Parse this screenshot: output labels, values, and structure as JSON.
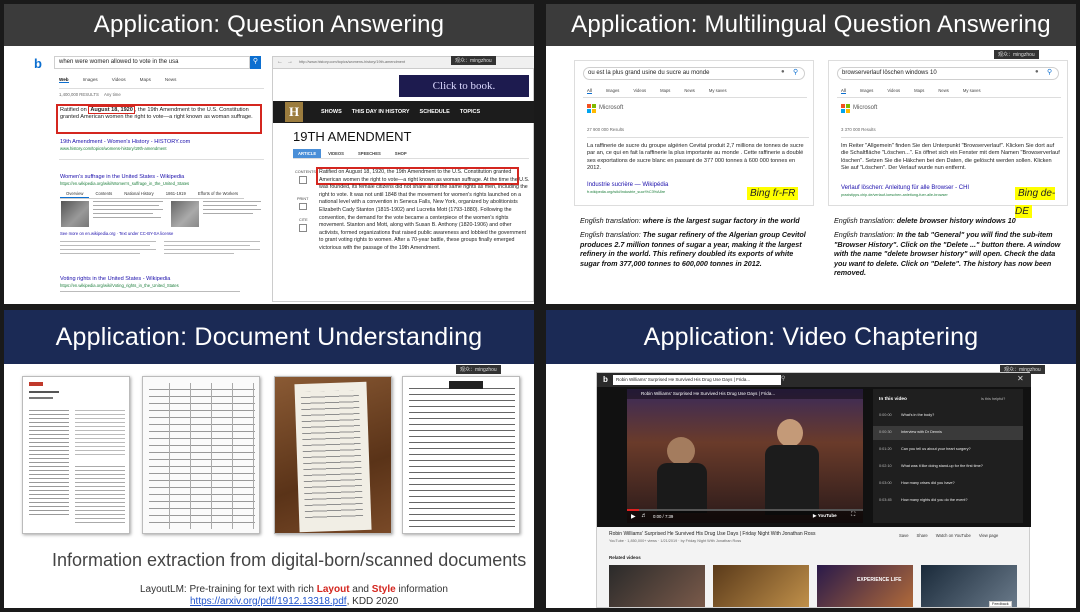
{
  "slides": {
    "qa": {
      "title": "Application: Question Answering",
      "presenter": "观众：mingzhou",
      "query": "when were women allowed to vote in the usa",
      "tabs": [
        "Web",
        "Images",
        "Videos",
        "Maps",
        "News"
      ],
      "answer_label": "1,400,000 RESULTS",
      "any_time": "Any time",
      "answer_text_pre": "Ratified on",
      "answer_highlight": "August 18, 1920",
      "answer_text_post": ", the 19th Amendment to the U.S. Constitution granted American women the right to vote—a right known as woman suffrage.",
      "result1_title": "19th Amendment - Women's History - HISTORY.com",
      "result1_url": "www.history.com/topics/womens-history/19th-amendment",
      "wiki_title": "Women's suffrage in the United States - Wikipedia",
      "wiki_url": "https://en.wikipedia.org/wiki/Women's_suffrage_in_the_United_States",
      "wiki_tabs": [
        "Overview",
        "Contents",
        "National History",
        "1861-1919",
        "Efforts of the Workers"
      ],
      "see_more": "See more on en.wikipedia.org · Text under CC-BY-SA license",
      "voting_title": "Voting rights in the United States - Wikipedia",
      "voting_url": "https://en.wikipedia.org/wiki/Voting_rights_in_the_United_States",
      "browser_url": "http://www.history.com/topics/womens-history/19th-amendment",
      "ad_text": "Click to book.",
      "nav_items": [
        "SHOWS",
        "THIS DAY IN HISTORY",
        "SCHEDULE",
        "TOPICS"
      ],
      "article_title": "19TH AMENDMENT",
      "article_tabs": [
        "ARTICLE",
        "VIDEOS",
        "SPEECHES",
        "SHOP"
      ],
      "side_labels": [
        "CONTENTS",
        "PRINT",
        "CITE"
      ],
      "article_highlight": "Ratified on August 18, 1920, the 19th Amendment to the U.S. Constitution granted American women the right to vote—a right known as woman suffrage.",
      "article_body": "At the time the U.S. was founded, its female citizens did not share all of the same rights as men, including the right to vote. It was not until 1848 that the movement for women's rights launched on a national level with a convention in Seneca Falls, New York, organized by abolitionists Elizabeth Cady Stanton (1815-1902) and Lucretia Mott (1793-1880). Following the convention, the demand for the vote became a centerpiece of the women's rights movement. Stanton and Mott, along with Susan B. Anthony (1820-1906) and other activists, formed organizations that raised public awareness and lobbied the government to grant voting rights to women. After a 70-year battle, these groups finally emerged victorious with the passage of the 19th Amendment."
    },
    "mqa": {
      "title": "Application: Multilingual Question Answering",
      "presenter": "观众：mingzhou",
      "fr_query": "ou est la plus grand usine du sucre au monde",
      "de_query": "browserverlauf löschen windows 10",
      "tabs": [
        "All",
        "Images",
        "Videos",
        "Maps",
        "News",
        "My saves"
      ],
      "fr_results": "27 900 000 Results",
      "de_results": "3 370 000 Results",
      "fr_answer": "La raffinerie de sucre du groupe algérien Cevital produit 2,7 millions de tonnes de sucre par an, ce qui en fait la raffinerie la plus importante au monde . Cette raffinerie a doublé ses exportations de sucre blanc en passant de 377 000 tonnes à 600 000 tonnes en 2012.",
      "de_answer": "Im Reiter \"Allgemein\" finden Sie den Unterpunkt \"Browserverlauf\". Klicken Sie dort auf die Schaltfläche \"Löschen...\". Es öffnet sich ein Fenster mit dem Namen \"Browserverlauf löschen\". Setzen Sie die Häkchen bei den Daten, die gelöscht werden sollen. Klicken Sie auf \"Löschen\". Der Verlauf wurde nun entfernt.",
      "fr_link": "Industrie sucrière — Wikipédia",
      "fr_link_url": "fr.wikipedia.org/wiki/Industrie_sucri%C3%A8re",
      "de_link": "Verlauf löschen: Anleitung für alle Browser - CHI",
      "de_link_url": "praxistipps.chip.de/verlauf-loeschen-anleitung-fuer-alle-browser",
      "fr_tag": "Bing fr-FR",
      "de_tag": "Bing de-DE",
      "fr_trans_label": "English translation:",
      "fr_trans_q": "where is the largest sugar factory in the world",
      "fr_trans_label2": "English translation:",
      "fr_trans_a": "The sugar refinery of the Algerian group Cevitol produces 2.7 million tonnes of sugar a year, making it the largest refinery in the world. This refinery doubled its exports of white sugar from 377,000 tonnes to 600,000 tonnes in 2012.",
      "de_trans_q": "delete browser history windows 10",
      "de_trans_a": "In the tab \"General\" you will find the sub-item \"Browser History\". Click on the \"Delete ...\" button there. A window with the name \"delete browser history\" will open. Check the data you want to delete. Click on \"Delete\". The history has now been removed."
    },
    "du": {
      "title": "Application: Document Understanding",
      "presenter": "观众：mingzhou",
      "caption": "Information extraction from digital-born/scanned documents",
      "ref_pre": "LayoutLM: Pre-training for text with rich ",
      "ref_layout": "Layout",
      "ref_and": " and ",
      "ref_style": "Style",
      "ref_post": " information",
      "ref_link": "https://arxiv.org/pdf/1912.13318.pdf",
      "ref_venue": ", KDD 2020"
    },
    "vc": {
      "title": "Application: Video Chaptering",
      "presenter": "观众：mingzhou",
      "video_title": "Robin Williams' Surprised He Survived His Drug Use Days | Frida...",
      "in_video": "In this video",
      "in_video_right": "Is this helpful?",
      "chapters": [
        {
          "time": "0:00:00",
          "label": "What's in the body?"
        },
        {
          "time": "0:00:30",
          "label": "Interview with Dr Dennis"
        },
        {
          "time": "0:01:20",
          "label": "Can you tell us about your heart surgery?"
        },
        {
          "time": "0:02:10",
          "label": "What was it like doing stand-up for the first time?"
        },
        {
          "time": "0:03:00",
          "label": "How many crises did you have?"
        },
        {
          "time": "0:03:45",
          "label": "How many nights did you do the event?"
        }
      ],
      "time_display": "0:00 / 7:39",
      "below_title": "Robin Williams' Surprised He Survived His Drug Use Days | Friday Night With Jonathan Ross",
      "below_meta": "YouTube · 1,850,000+ views · 1/21/2019 · by Friday Night With Jonathan Ross",
      "actions": [
        "Save",
        "Share",
        "Watch on YouTube",
        "View page"
      ],
      "related": "Related videos",
      "thumb_labels": [
        "",
        "",
        "EXPERIENCE LIFE",
        ""
      ],
      "feedback": "Feedback"
    }
  }
}
